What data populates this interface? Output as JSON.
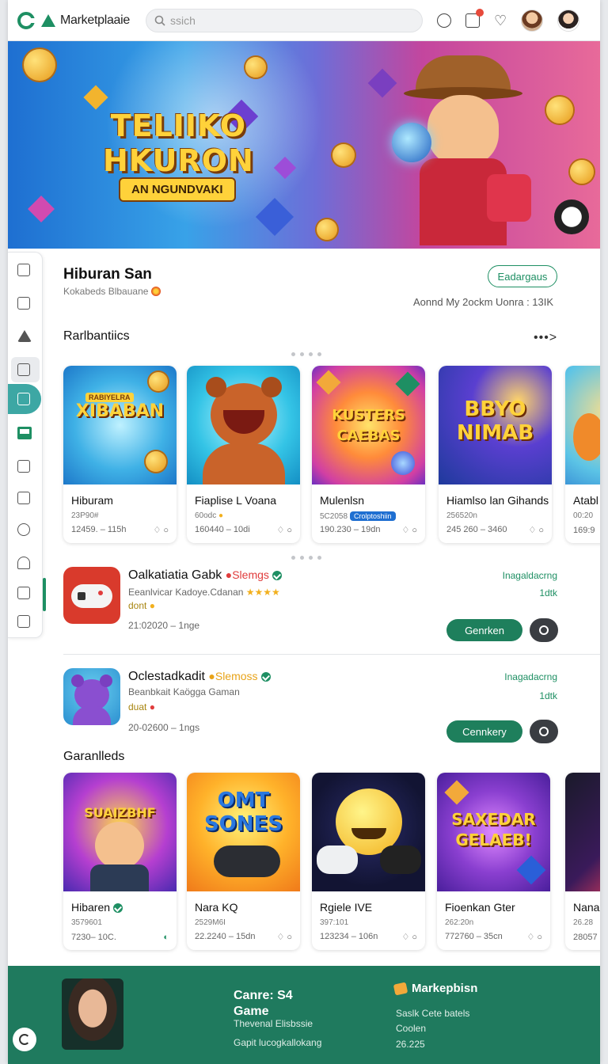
{
  "app": {
    "brand": "Marketplaaie"
  },
  "search": {
    "placeholder": "ssich"
  },
  "icons": {
    "header": [
      "compass-icon",
      "bag-icon",
      "heart-icon"
    ],
    "notification_color": "#e74a3b",
    "accent": "#1e8f63"
  },
  "banner": {
    "title_line1": "TELIIKO",
    "title_line2": "HKURON",
    "subtitle": "AN NGUNDVAKI"
  },
  "section": {
    "title": "Hiburan San",
    "subtitle": "Kokabeds Blbauane",
    "outline_button": "Eadargaus",
    "right_text": "Aonnd My  2ockm Uonra : 13IK"
  },
  "row1": {
    "title": "Rarlbantiics",
    "more": "•••>",
    "cards": [
      {
        "art": "XIBABAN",
        "art_top": "RABIYELRA",
        "name": "Hiburam",
        "meta": "23P90#",
        "foot": "12459. – 115h",
        "tag": ""
      },
      {
        "art": "",
        "art_top": "",
        "name": "Fiaplise L Voana",
        "meta": "60odc",
        "foot": "160440 – 10di",
        "tag": ""
      },
      {
        "art": "KUSTERS CAEBAS",
        "art_top": "",
        "name": "Mulenlsn",
        "meta": "5C2058",
        "foot": "190.230 – 19dn",
        "tag": "Crolptoshiin"
      },
      {
        "art": "BBYO NIMAB",
        "art_top": "",
        "name": "Hiamlso lan Gihands",
        "meta": "256520n",
        "foot": "245 260 – 3460",
        "tag": ""
      },
      {
        "art": "",
        "art_top": "",
        "name": "Atabl",
        "meta": "00:20",
        "foot": "169:9",
        "tag": ""
      }
    ]
  },
  "list": [
    {
      "title": "Oalkatiatia Gabk",
      "highlight": "Slemgs",
      "desc": "Eeanlvicar Kadoye.Cdanan",
      "stars": "★★★★",
      "tag": "dont",
      "date": "21:02020 – 1nge",
      "right_label": "Inagaldacrng",
      "right_count": "1dtk",
      "button": "Genrken"
    },
    {
      "title": "Oclestadkadit",
      "highlight": "Slemoss",
      "desc": "Beanbkait Kaögga Gaman",
      "stars": "",
      "tag": "duat",
      "date": "20-02600 – 1ngs",
      "right_label": "Inagadacrng",
      "right_count": "1dtk",
      "button": "Cennkery"
    }
  ],
  "row2": {
    "title": "Garanlleds",
    "cards": [
      {
        "art": "SUAIZBHF",
        "name": "Hibaren",
        "meta": "3579601",
        "foot": "7230– 10C."
      },
      {
        "art": "OMT SONES",
        "name": "Nara KQ",
        "meta": "2529M6I",
        "foot": "22.2240 – 15dn"
      },
      {
        "art": "",
        "name": "Rgiele IVE",
        "meta": "397:101",
        "foot": "123234 – 106n"
      },
      {
        "art": "SAXEDAR GELAEB!",
        "name": "Fioenkan Gter",
        "meta": "262:20n",
        "foot": "772760 – 35cn"
      },
      {
        "art": "",
        "name": "Nanak",
        "meta": "26.28",
        "foot": "28057"
      }
    ]
  },
  "footer": {
    "title_line1": "Canre: S4",
    "title_line2": "Game",
    "line1": "Thevenal Elisbssie",
    "line2": "Gapit lucogkallokang",
    "brand": "Markepbisn",
    "right1": "Saslk Cete batels",
    "right2": "Coolen",
    "right3": "26.225"
  }
}
